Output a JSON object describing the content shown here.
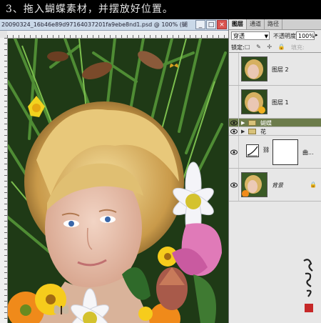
{
  "caption": "3、拖入蝴蝶素材，并摆放好位置。",
  "document": {
    "title": "20090324_16b46e89d97164037201fa9ebe8nd1.psd @ 100% (蝴",
    "min_glyph": "_",
    "max_glyph": "□",
    "close_glyph": "×"
  },
  "layers_panel": {
    "tabs": [
      "图层",
      "通道",
      "路径"
    ],
    "blend_mode": "穿透",
    "opacity_label": "不透明度:",
    "opacity_value": "100%",
    "lock_label": "锁定:",
    "lock_icons": "□ ✎ ✢ 🔒",
    "fill_label": "填充:",
    "layers": [
      {
        "name": "图层 2",
        "type": "image",
        "visible": false
      },
      {
        "name": "图层 1",
        "type": "image",
        "visible": false
      },
      {
        "name": "蝴蝶",
        "type": "group",
        "visible": true,
        "selected": true
      },
      {
        "name": "花",
        "type": "group",
        "visible": true
      },
      {
        "name": "曲...",
        "type": "adjustment",
        "visible": true
      },
      {
        "name": "背景",
        "type": "background",
        "visible": true,
        "locked": true
      }
    ]
  },
  "colors": {
    "panel_bg": "#e7e7e7",
    "selected_layer": "#6c7c4b",
    "caption_bg": "#000000"
  },
  "icons": [
    "eye-icon",
    "folder-icon",
    "expand-triangle-icon",
    "link-icon",
    "lock-icon",
    "curves-adjustment-icon"
  ]
}
